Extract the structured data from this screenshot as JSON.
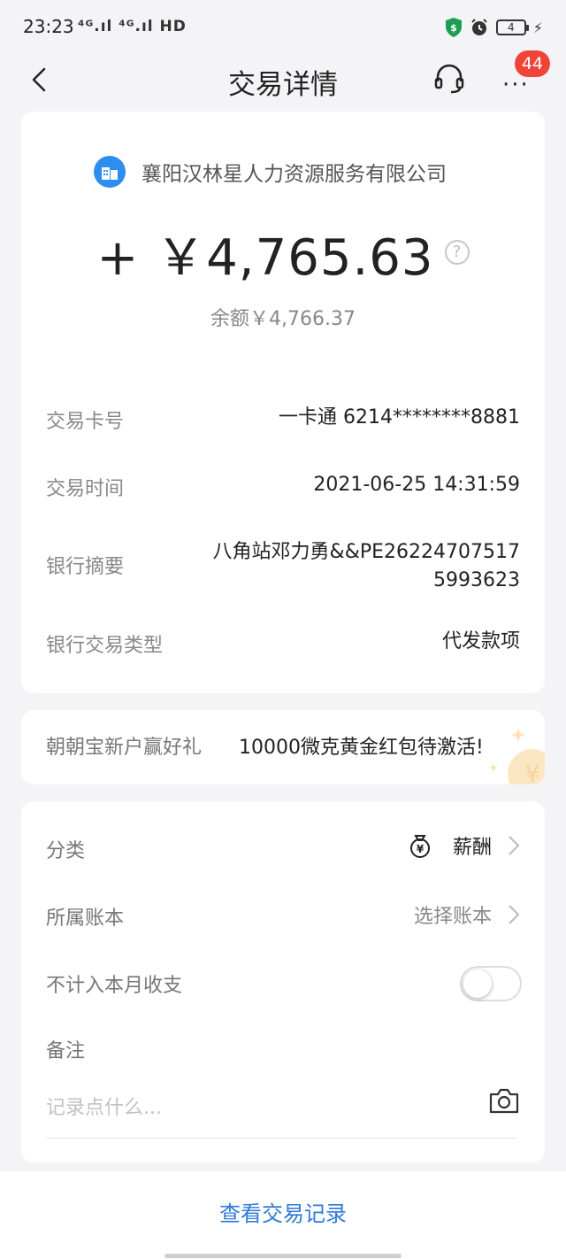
{
  "status_bar": {
    "time": "23:23",
    "network": "⁴ᴳ.ıl ⁴ᴳ.ıl HD",
    "battery": "4"
  },
  "nav": {
    "title": "交易详情",
    "badge_count": "44"
  },
  "transaction": {
    "merchant": "襄阳汉林星人力资源服务有限公司",
    "amount": "+ ￥4,765.63",
    "help_icon": "?",
    "balance": "余额￥4,766.37",
    "details": [
      {
        "label": "交易卡号",
        "value": "一卡通 6214********8881"
      },
      {
        "label": "交易时间",
        "value": "2021-06-25 14:31:59"
      },
      {
        "label": "银行摘要",
        "value": "八角站邓力勇&&PE26224707517\n5993623"
      },
      {
        "label": "银行交易类型",
        "value": "代发款项"
      }
    ]
  },
  "promo": {
    "label": "朝朝宝新户赢好礼",
    "text": "10000微克黄金红包待激活!"
  },
  "settings": {
    "category_label": "分类",
    "category_value": "薪酬",
    "ledger_label": "所属账本",
    "ledger_value": "选择账本",
    "exclude_label": "不计入本月收支",
    "exclude_on": false,
    "note_label": "备注",
    "note_placeholder": "记录点什么..."
  },
  "bottom": {
    "view_records": "查看交易记录"
  },
  "colors": {
    "accent_blue": "#2f7ad8",
    "badge_red": "#f04438",
    "merchant_icon_blue": "#2d8ef0"
  }
}
